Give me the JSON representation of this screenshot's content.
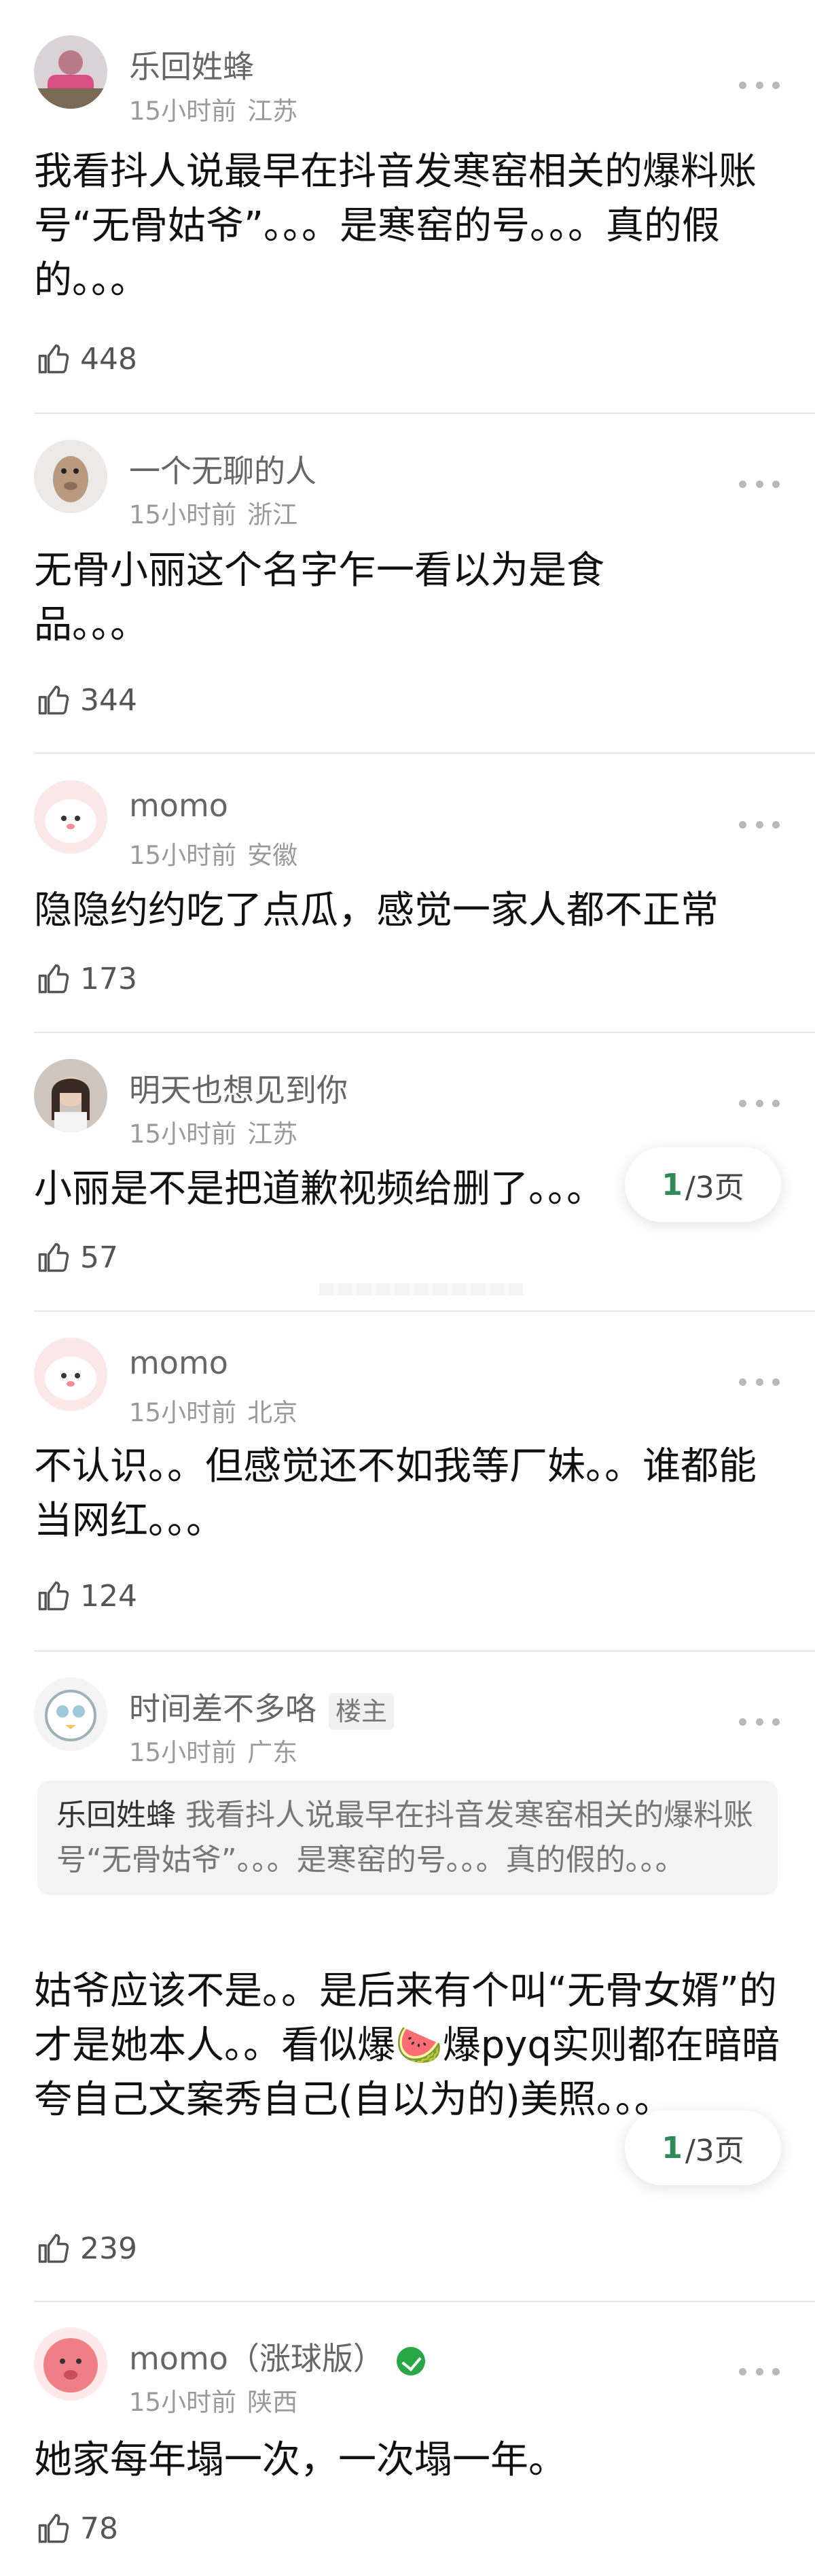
{
  "page": {
    "current": "1",
    "total_label": "/3页"
  },
  "comments": [
    {
      "username": "乐回姓蜂",
      "time": "15小时前",
      "location": "江苏",
      "text": "我看抖人说最早在抖音发寒窑相关的爆料账号“无骨姑爷”。。。是寒窑的号。。。真的假的。。。",
      "likes": "448"
    },
    {
      "username": "一个无聊的人",
      "time": "15小时前",
      "location": "浙江",
      "text": "无骨小丽这个名字乍一看以为是食品。。。",
      "likes": "344"
    },
    {
      "username": "momo",
      "time": "15小时前",
      "location": "安徽",
      "text": "隐隐约约吃了点瓜，感觉一家人都不正常",
      "likes": "173"
    },
    {
      "username": "明天也想见到你",
      "time": "15小时前",
      "location": "江苏",
      "text": "小丽是不是把道歉视频给删了。。。",
      "likes": "57"
    },
    {
      "username": "momo",
      "time": "15小时前",
      "location": "北京",
      "text": "不认识。。但感觉还不如我等厂妹。。谁都能当网红。。。",
      "likes": "124"
    },
    {
      "username": "时间差不多咯",
      "badge": "楼主",
      "time": "15小时前",
      "location": "广东",
      "quote_name": "乐回姓蜂",
      "quote_text": "我看抖人说最早在抖音发寒窑相关的爆料账号“无骨姑爷”。。。是寒窑的号。。。真的假的。。。",
      "text": "姑爷应该不是。。是后来有个叫“无骨女婿”的才是她本人。。看似爆🍉爆pyq实则都在暗暗夸自己文案秀自己(自以为的)美照。。。",
      "likes": "239"
    },
    {
      "username": "momo（涨球版）",
      "time": "15小时前",
      "location": "陕西",
      "text": "她家每年塌一次，一次塌一年。",
      "likes": "78"
    }
  ],
  "colors": {
    "accent": "#2e8b57",
    "verified": "#29a744"
  }
}
